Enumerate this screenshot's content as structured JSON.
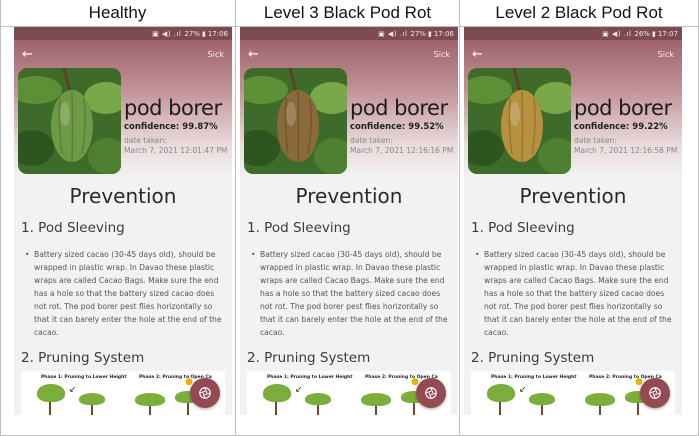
{
  "columns": [
    {
      "header": "Healthy",
      "status": {
        "icons": "▣ ◀) .ıl",
        "battery": "27%",
        "time": "17:06"
      },
      "back_icon": "←",
      "sick_label": "Sick",
      "disease": "pod borer",
      "confidence": "confidence: 99.87%",
      "date_label": "date taken:",
      "date_value": "March 7, 2021 12:01:47 PM",
      "pod_color": "#6f9a45",
      "prevention": "Prevention",
      "section1": "1. Pod Sleeving",
      "bullet": "Battery sized cacao (30-45 days old), should be wrapped in plastic wrap. In Davao these plastic wraps are called Cacao Bags. Make sure the end has a hole so that the battery sized cacao does not rot. The pod borer pest flies horizontally so that it can barely enter the hole at the end of the cacao.",
      "section2": "2. Pruning System",
      "phase1": "Phase 1: Pruning to Lower Height",
      "phase2": "Phase 2: Pruning to Open Ca"
    },
    {
      "header": "Level 3 Black Pod Rot",
      "status": {
        "icons": "▣ ◀) .ıl",
        "battery": "27%",
        "time": "17:06"
      },
      "back_icon": "←",
      "sick_label": "Sick",
      "disease": "pod borer",
      "confidence": "confidence: 99.52%",
      "date_label": "date taken:",
      "date_value": "March 7, 2021 12:16:16 PM",
      "pod_color": "#8a6a3a",
      "prevention": "Prevention",
      "section1": "1. Pod Sleeving",
      "bullet": "Battery sized cacao (30-45 days old), should be wrapped in plastic wrap. In Davao these plastic wraps are called Cacao Bags. Make sure the end has a hole so that the battery sized cacao does not rot. The pod borer pest flies horizontally so that it can barely enter the hole at the end of the cacao.",
      "section2": "2. Pruning System",
      "phase1": "Phase 1: Pruning to Lower Height",
      "phase2": "Phase 2: Pruning to Open Ca"
    },
    {
      "header": "Level 2 Black Pod Rot",
      "status": {
        "icons": "▣ ◀) .ıl",
        "battery": "26%",
        "time": "17:07"
      },
      "back_icon": "←",
      "sick_label": "Sick",
      "disease": "pod borer",
      "confidence": "confidence: 99.22%",
      "date_label": "date taken:",
      "date_value": "March 7, 2021 12:16:58 PM",
      "pod_color": "#b8913f",
      "prevention": "Prevention",
      "section1": "1. Pod Sleeving",
      "bullet": "Battery sized cacao (30-45 days old), should be wrapped in plastic wrap. In Davao these plastic wraps are called Cacao Bags. Make sure the end has a hole so that the battery sized cacao does not rot. The pod borer pest flies horizontally so that it can barely enter the hole at the end of the cacao.",
      "section2": "2. Pruning System",
      "phase1": "Phase 1: Pruning to Lower Height",
      "phase2": "Phase 2: Pruning to Open Ca"
    }
  ],
  "colors": {
    "status_bar": "#7e4a52",
    "hero_top": "#a0636c",
    "fab": "#934a53",
    "background": "#f2f2f2"
  },
  "icons": {
    "back": "arrow-left-icon",
    "fab": "aperture-icon"
  }
}
